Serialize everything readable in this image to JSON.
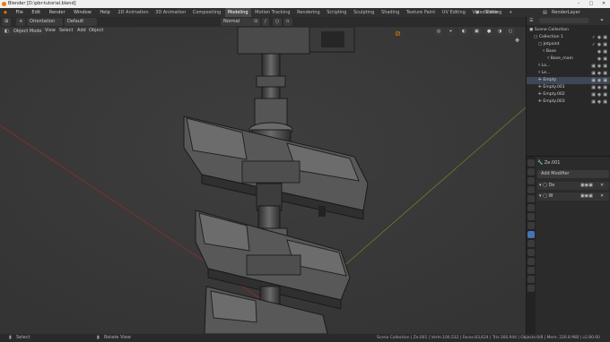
{
  "window": {
    "title": "Blender [D:\\pbr-tutorial.blend]",
    "min": "–",
    "max": "□",
    "close": "✕"
  },
  "menu": [
    "File",
    "Edit",
    "Render",
    "Window",
    "Help"
  ],
  "workspaces": [
    "2D Animation",
    "3D Animation",
    "Compositing",
    "Modeling",
    "Motion Tracking",
    "Rendering",
    "Scripting",
    "Sculpting",
    "Shading",
    "Texture Paint",
    "UV Editing",
    "Video Editing"
  ],
  "active_workspace": "Modeling",
  "scene": {
    "label": "Scene",
    "view_layer": "RenderLayer"
  },
  "header": {
    "orientation": "Orientation",
    "default": "Default",
    "normal": "Normal"
  },
  "viewport_header": {
    "mode": "Object Mode",
    "view": "View",
    "select": "Select",
    "add": "Add",
    "object": "Object"
  },
  "outliner": {
    "root": "Scene Collection",
    "rows": [
      {
        "label": "Collection 1",
        "indent": 1
      },
      {
        "label": "Jetpoint",
        "indent": 2
      },
      {
        "label": "Base",
        "indent": 3
      },
      {
        "label": "Base_main",
        "indent": 4
      },
      {
        "label": "Lo...",
        "indent": 2
      },
      {
        "label": "Le...",
        "indent": 2
      },
      {
        "label": "Empty",
        "indent": 2,
        "selected": true
      },
      {
        "label": "Empty.001",
        "indent": 2
      },
      {
        "label": "Empty.002",
        "indent": 2
      },
      {
        "label": "Empty.003",
        "indent": 2
      }
    ]
  },
  "properties": {
    "object_name": "Ze.001",
    "add_modifier": "Add Modifier",
    "modifiers": [
      {
        "name": "De"
      },
      {
        "name": "W"
      }
    ]
  },
  "status": {
    "left": "Select",
    "middle": "Rotate View",
    "right": "Scene Collection | Ze.001 | Verts:100,532 | Faces:83,624 | Tris:166,944 | Objects:0/8 | Mem: 226.8 MiB | v2.80.60"
  },
  "colors": {
    "accent": "#4772b3",
    "active_tab": "#4a4a4a"
  }
}
